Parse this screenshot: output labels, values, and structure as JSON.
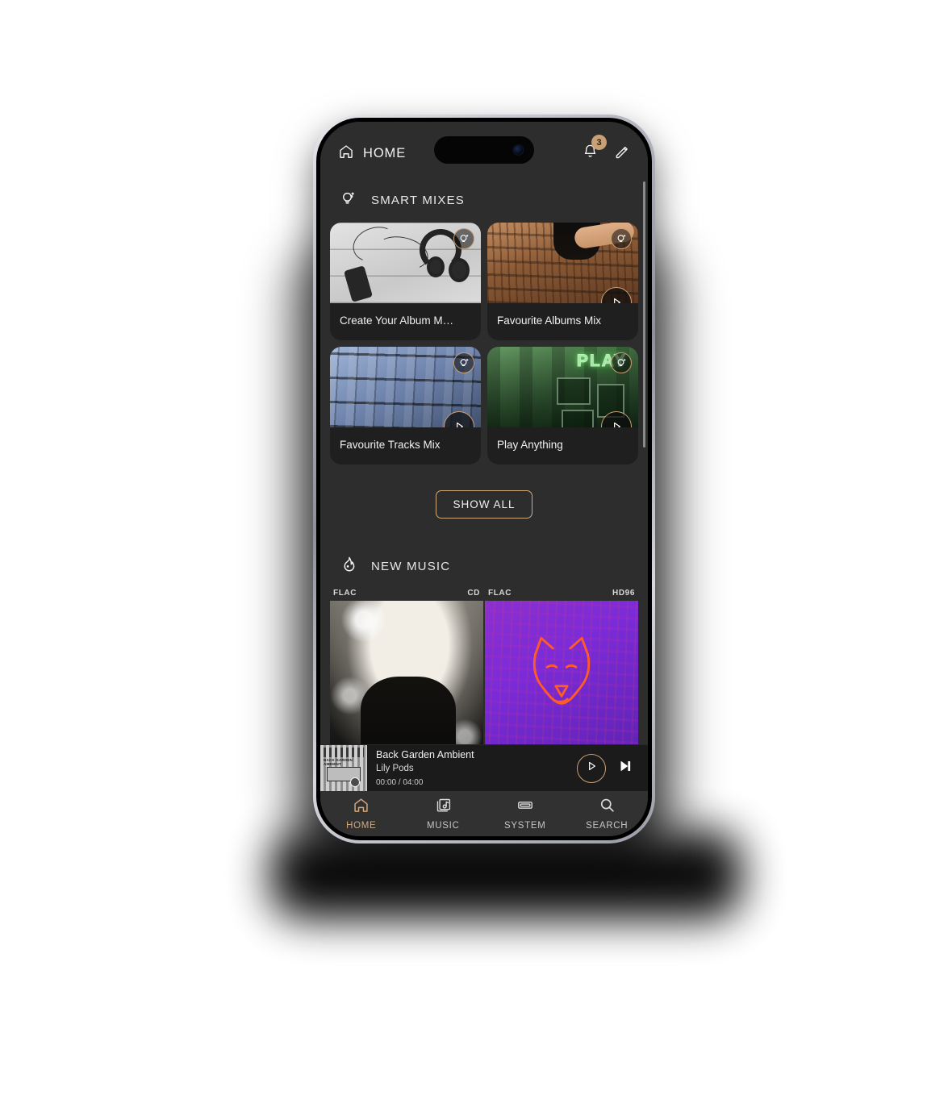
{
  "header": {
    "title": "HOME",
    "home_icon": "home-icon",
    "notifications_icon": "bell-icon",
    "notifications_badge": "3",
    "edit_icon": "pencil-icon"
  },
  "sections": {
    "smart_mixes": {
      "title": "SMART MIXES",
      "icon": "lightbulb-icon",
      "cards": [
        {
          "label": "Create Your Album M…",
          "badge_icon": "lightbulb-icon",
          "has_play": false
        },
        {
          "label": "Favourite Albums Mix",
          "badge_icon": "lightbulb-icon",
          "has_play": true
        },
        {
          "label": "Favourite Tracks Mix",
          "badge_icon": "lightbulb-icon",
          "has_play": true
        },
        {
          "label": "Play Anything",
          "badge_icon": "lightbulb-icon",
          "has_play": true
        }
      ],
      "show_all_label": "SHOW ALL"
    },
    "new_music": {
      "title": "NEW MUSIC",
      "icon": "flame-icon",
      "items": [
        {
          "format": "FLAC",
          "quality": "CD"
        },
        {
          "format": "FLAC",
          "quality": "HD96"
        }
      ]
    }
  },
  "now_playing": {
    "title": "Back Garden Ambient",
    "artist": "Lily Pods",
    "elapsed": "00:00",
    "separator": "/",
    "duration": "04:00",
    "time_display": "00:00 / 04:00",
    "play_icon": "play-icon",
    "next_icon": "skip-next-icon",
    "artwork_caption": "BACK GARDEN AMBIENT"
  },
  "tabbar": {
    "items": [
      {
        "label": "HOME",
        "icon": "home-icon",
        "active": true
      },
      {
        "label": "MUSIC",
        "icon": "music-library-icon",
        "active": false
      },
      {
        "label": "SYSTEM",
        "icon": "device-icon",
        "active": false
      },
      {
        "label": "SEARCH",
        "icon": "search-icon",
        "active": false
      }
    ]
  },
  "colors": {
    "accent": "#d2a97c",
    "badge": "#c99f74",
    "background": "#2d2d2d",
    "card": "#1f1f1f",
    "now_playing_bg": "#1b1b1b",
    "tabbar_bg": "#313131",
    "text": "#f0f0f0"
  },
  "artwork_text": {
    "play_neon": "PLAY"
  }
}
